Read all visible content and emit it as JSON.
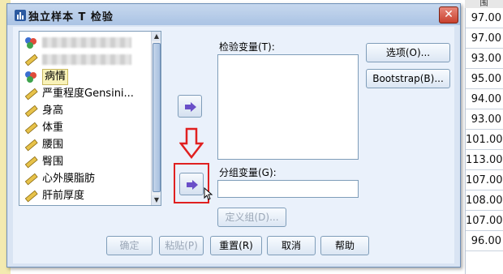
{
  "spreadsheet": {
    "column_header": "围",
    "values": [
      "97.00",
      "97.00",
      "93.00",
      "95.00",
      "94.00",
      "93.00",
      "101.00",
      "113.00",
      "107.00",
      "108.00",
      "107.00",
      "96.00"
    ]
  },
  "dialog": {
    "title": "独立样本 T 检验",
    "close_label": "✕",
    "variables": [
      {
        "label": "",
        "type": "nominal-icon",
        "redacted": true
      },
      {
        "label": "",
        "type": "scale-icon",
        "redacted": true
      },
      {
        "label": "病情",
        "type": "nominal-icon",
        "selected": true
      },
      {
        "label": "严重程度Gensini...",
        "type": "scale-icon"
      },
      {
        "label": "身高",
        "type": "scale-icon"
      },
      {
        "label": "体重",
        "type": "scale-icon"
      },
      {
        "label": "腰围",
        "type": "scale-icon"
      },
      {
        "label": "臀围",
        "type": "scale-icon"
      },
      {
        "label": "心外膜脂肪",
        "type": "scale-icon"
      },
      {
        "label": "肝前厚度",
        "type": "scale-icon"
      }
    ],
    "test_variable_label": "检验变量(T):",
    "group_variable_label": "分组变量(G):",
    "define_groups_label": "定义组(D)...",
    "side_buttons": {
      "options": "选项(O)...",
      "bootstrap": "Bootstrap(B)..."
    },
    "bottom_buttons": {
      "ok": "确定",
      "paste": "粘贴(P)",
      "reset": "重置(R)",
      "cancel": "取消",
      "help": "帮助"
    },
    "colors": {
      "accent": "#6a4fc8",
      "highlight": "#e02020",
      "title_bg": "#aac3e4"
    }
  }
}
